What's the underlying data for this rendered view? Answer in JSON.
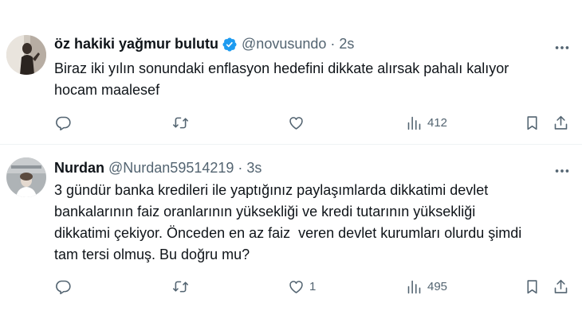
{
  "tweets": [
    {
      "display_name": "öz hakiki yağmur bulutu",
      "verified": true,
      "handle": "@novusundo",
      "separator": "·",
      "time": "2s",
      "text_lines": [
        "Biraz iki yılın sonundaki enflasyon hedefini dikkate alırsak pahalı kalıyor",
        "hocam maalesef"
      ],
      "reply_count": "",
      "retweet_count": "",
      "like_count": "",
      "view_count": "412"
    },
    {
      "display_name": "Nurdan",
      "verified": false,
      "handle": "@Nurdan59514219",
      "separator": "·",
      "time": "3s",
      "text_lines": [
        "3 gündür banka kredileri ile yaptığınız paylaşımlarda dikkatimi devlet",
        "bankalarının faiz oranlarının yüksekliği ve kredi tutarının yüksekliği",
        "dikkatimi çekiyor. Önceden en az faiz  veren devlet kurumları olurdu şimdi",
        "tam tersi olmuş. Bu doğru mu?"
      ],
      "reply_count": "",
      "retweet_count": "",
      "like_count": "1",
      "view_count": "495"
    }
  ],
  "colors": {
    "text_primary": "#0f1419",
    "text_secondary": "#536471",
    "verified_blue": "#1d9bf0",
    "divider": "#eff3f4"
  },
  "icons": [
    "more-icon",
    "reply-icon",
    "retweet-icon",
    "like-icon",
    "views-icon",
    "bookmark-icon",
    "share-icon",
    "verified-icon"
  ]
}
